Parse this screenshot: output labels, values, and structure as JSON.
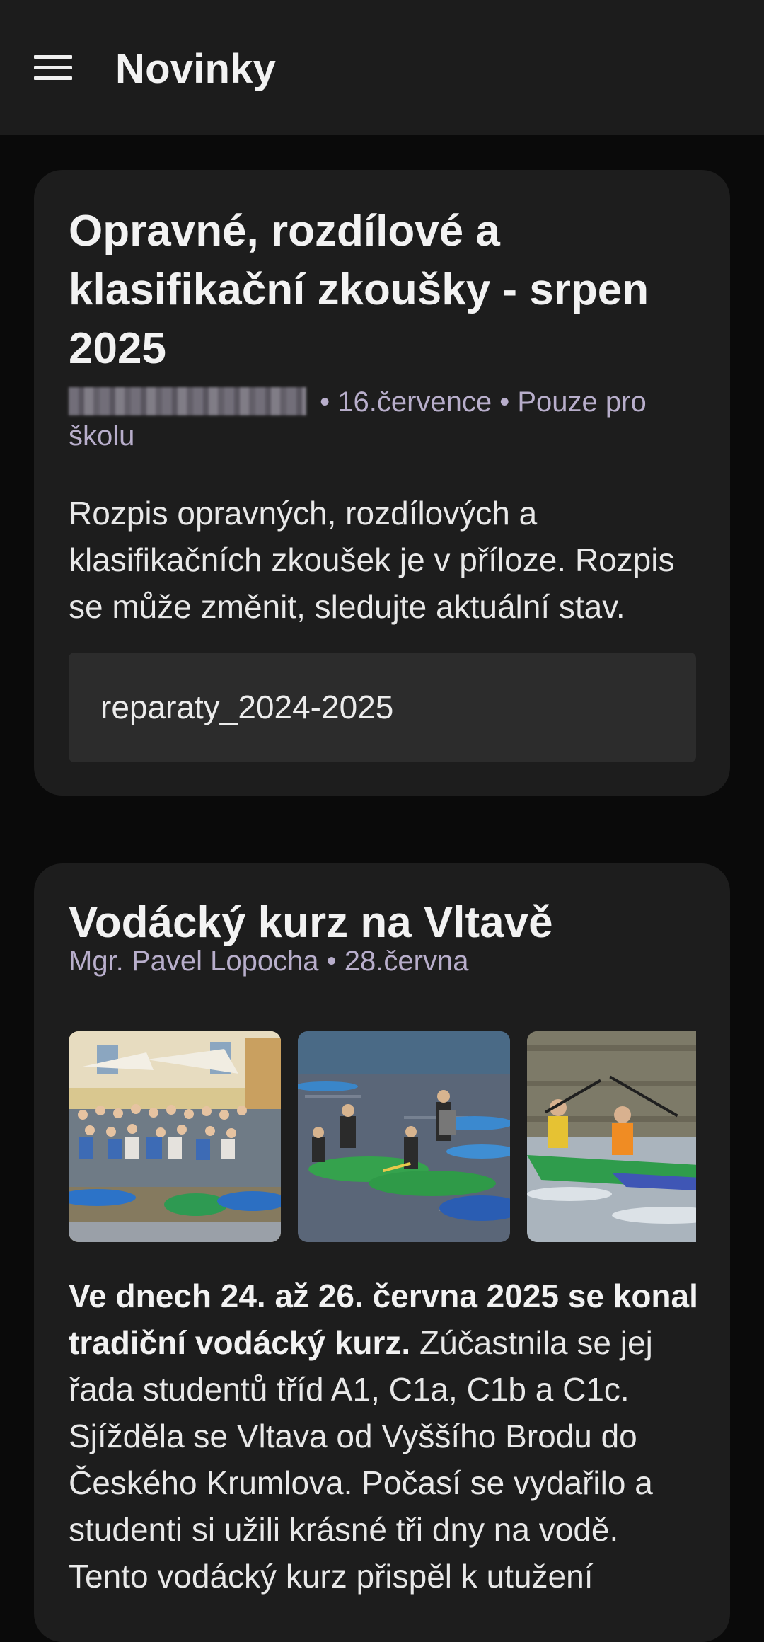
{
  "app_bar": {
    "title": "Novinky",
    "menu_icon": "hamburger-menu-icon"
  },
  "posts": [
    {
      "title": "Opravné, rozdílové a klasifikační zkoušky - srpen 2025",
      "author_redacted": true,
      "meta_rest": " • 16.července • Pouze pro školu",
      "body": "Rozpis opravných, rozdílových a klasifikačních zkoušek je v příloze. Rozpis se může změnit, sledujte aktuální stav.",
      "attachment": "reparaty_2024-2025"
    },
    {
      "title": "Vodácký kurz na Vltavě",
      "meta": "Mgr. Pavel Lopocha • 28.června",
      "body_bold": "Ve dnech 24. až 26. června 2025 se konal tradiční vodácký kurz.",
      "body_rest": " Zúčastnila se jej řada studentů tříd A1, C1a, C1b a C1c. Sjížděla se Vltava od Vyššího Brodu do Českého Krumlova. Počasí se vydařilo a studenti si užili krásné tři dny na vodě. Tento vodácký kurz přispěl k utužení"
    }
  ]
}
